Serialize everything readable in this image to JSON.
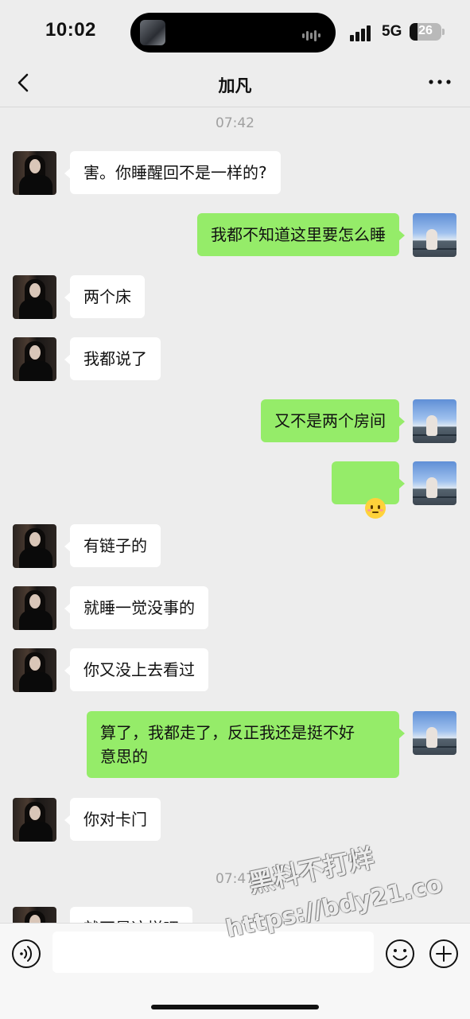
{
  "status_bar": {
    "time": "10:02",
    "network": "5G",
    "battery_level": "26",
    "battery_percent": 26
  },
  "nav": {
    "title": "加凡",
    "back_icon": "chevron-left-icon",
    "more_icon": "more-dots-icon"
  },
  "chat": {
    "timestamps": [
      "07:42",
      "07:47"
    ],
    "messages": [
      {
        "from": "other",
        "text": "害。你睡醒回不是一样的?"
      },
      {
        "from": "me",
        "text": "我都不知道这里要怎么睡"
      },
      {
        "from": "other",
        "text": "两个床"
      },
      {
        "from": "other",
        "text": "我都说了"
      },
      {
        "from": "me",
        "text": "又不是两个房间"
      },
      {
        "from": "me",
        "emoji": "blushing-smile-emoji"
      },
      {
        "from": "other",
        "text": "有链子的"
      },
      {
        "from": "other",
        "text": "就睡一觉没事的"
      },
      {
        "from": "other",
        "text": "你又没上去看过"
      },
      {
        "from": "me",
        "text": "算了，我都走了，反正我还是挺不好\n意思的"
      },
      {
        "from": "other",
        "text": "你对卡门"
      },
      {
        "from": "other",
        "text": "就不是这样吧"
      }
    ]
  },
  "input_bar": {
    "voice_icon": "voice-icon",
    "value": "",
    "emoji_icon": "emoji-icon",
    "plus_icon": "plus-circle-icon"
  },
  "watermark": {
    "line1": "黑料不打烊",
    "line2": "https://bdy21.co"
  },
  "colors": {
    "background": "#ededed",
    "my_bubble": "#95ec69",
    "other_bubble": "#ffffff",
    "timestamp": "#a0a0a0"
  }
}
